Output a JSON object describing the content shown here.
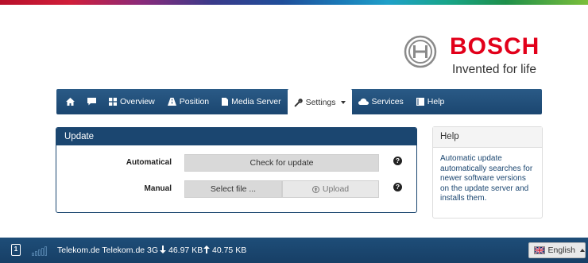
{
  "brand": {
    "name": "BOSCH",
    "tagline": "Invented for life",
    "color": "#e2001a"
  },
  "navbar": {
    "items": [
      {
        "label": "",
        "icon": "home-icon"
      },
      {
        "label": "",
        "icon": "chat-icon"
      },
      {
        "label": "Overview",
        "icon": "grid-icon"
      },
      {
        "label": "Position",
        "icon": "road-icon"
      },
      {
        "label": "Media Server",
        "icon": "file-icon"
      },
      {
        "label": "Settings",
        "icon": "wrench-icon",
        "active": true,
        "dropdown": true
      },
      {
        "label": "Services",
        "icon": "cloud-icon"
      },
      {
        "label": "Help",
        "icon": "book-icon"
      }
    ],
    "color": "#1b4670"
  },
  "update": {
    "title": "Update",
    "automatical": {
      "label": "Automatical",
      "button": "Check for update"
    },
    "manual": {
      "label": "Manual",
      "select_button": "Select file ...",
      "upload_button": "Upload"
    }
  },
  "help": {
    "title": "Help",
    "text": "Automatic update automatically searches for newer software versions on the update server and installs them."
  },
  "status": {
    "sim": "1",
    "carrier": "Telekom.de Telekom.de 3G",
    "download": "46.97 KB",
    "upload": "40.75 KB",
    "language": "English"
  }
}
